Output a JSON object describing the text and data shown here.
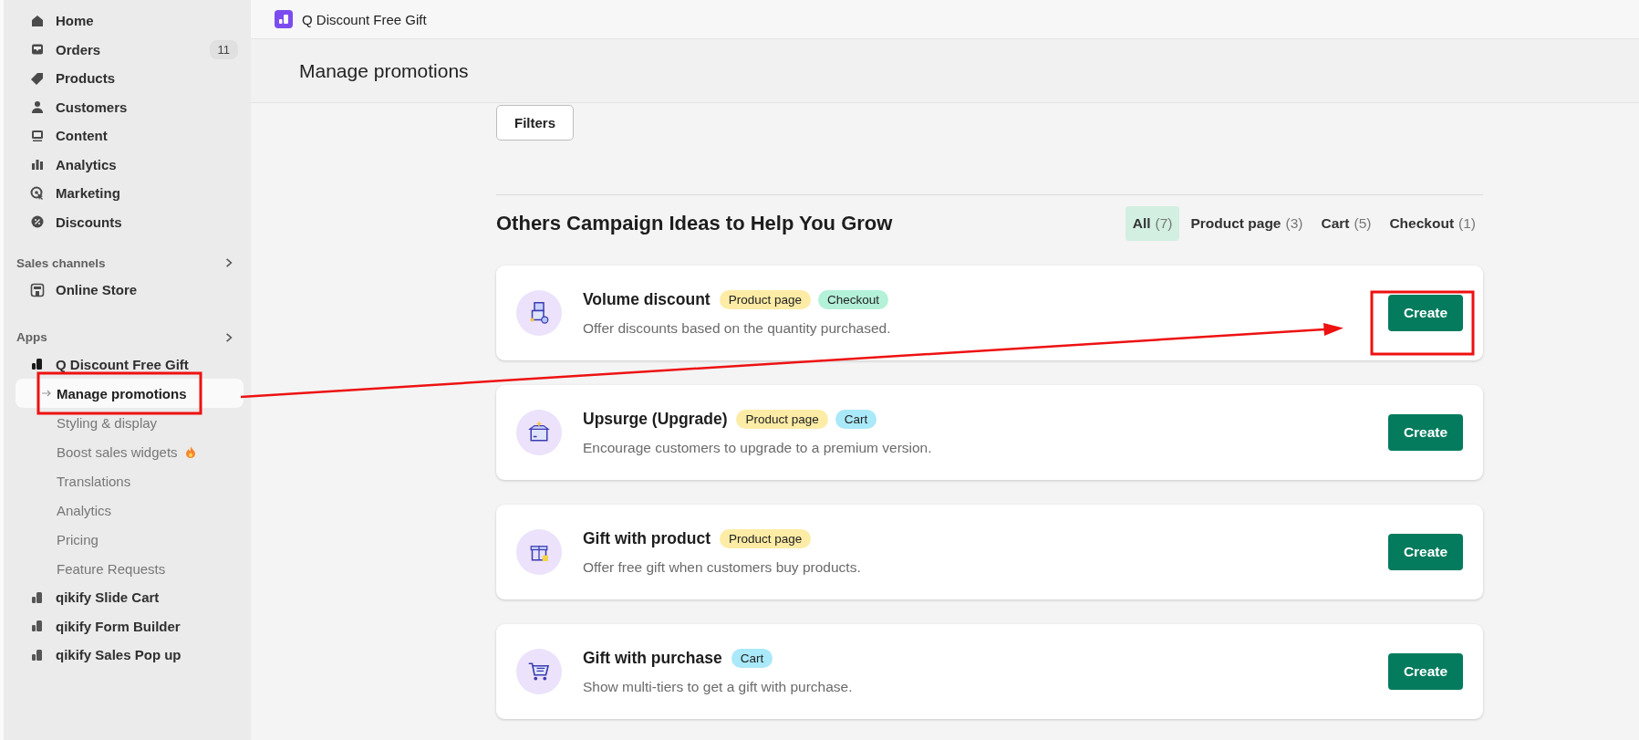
{
  "sidebar": {
    "nav": [
      {
        "label": "Home",
        "kind": "home",
        "selected": false
      },
      {
        "label": "Orders",
        "kind": "inbox",
        "badge": "11",
        "selected": false
      },
      {
        "label": "Products",
        "kind": "tag",
        "selected": false
      },
      {
        "label": "Customers",
        "kind": "person",
        "selected": false
      },
      {
        "label": "Content",
        "kind": "content",
        "selected": false
      },
      {
        "label": "Analytics",
        "kind": "bars",
        "selected": false
      },
      {
        "label": "Marketing",
        "kind": "target",
        "selected": false
      },
      {
        "label": "Discounts",
        "kind": "discount",
        "selected": false
      }
    ],
    "sales_channels": {
      "title": "Sales channels",
      "items": [
        {
          "label": "Online Store",
          "selected": false
        }
      ]
    },
    "apps": {
      "title": "Apps",
      "items": [
        {
          "label": "Q Discount Free Gift",
          "selected": false,
          "children": [
            {
              "label": "Manage promotions",
              "selected": true
            },
            {
              "label": "Styling & display",
              "selected": false
            },
            {
              "label": "Boost sales widgets",
              "hot": true,
              "selected": false
            },
            {
              "label": "Translations",
              "selected": false
            },
            {
              "label": "Analytics",
              "selected": false
            },
            {
              "label": "Pricing",
              "selected": false
            },
            {
              "label": "Feature Requests",
              "selected": false
            }
          ]
        },
        {
          "label": "qikify Slide Cart",
          "selected": false
        },
        {
          "label": "qikify Form Builder",
          "selected": false
        },
        {
          "label": "qikify Sales Pop up",
          "selected": false
        }
      ]
    }
  },
  "app_bar": {
    "title": "Q Discount Free Gift"
  },
  "page": {
    "title": "Manage promotions",
    "filters_button": "Filters",
    "ideas": {
      "heading": "Others Campaign Ideas to Help You Grow",
      "tabs": [
        {
          "label": "All",
          "count": "(7)",
          "selected": true
        },
        {
          "label": "Product page",
          "count": "(3)",
          "selected": false
        },
        {
          "label": "Cart",
          "count": "(5)",
          "selected": false
        },
        {
          "label": "Checkout",
          "count": "(1)",
          "selected": false
        }
      ],
      "cards": [
        {
          "title": "Volume discount",
          "kind": "boxes",
          "tags": [
            {
              "label": "Product page",
              "color": "#fdeca6"
            },
            {
              "label": "Checkout",
              "color": "#b4f1d9"
            }
          ],
          "description": "Offer discounts based on the quantity purchased.",
          "button": "Create"
        },
        {
          "title": "Upsurge (Upgrade)",
          "kind": "box",
          "tags": [
            {
              "label": "Product page",
              "color": "#fdeca6"
            },
            {
              "label": "Cart",
              "color": "#a9e9f9"
            }
          ],
          "description": "Encourage customers to upgrade to a premium version.",
          "button": "Create"
        },
        {
          "title": "Gift with product",
          "kind": "gift",
          "tags": [
            {
              "label": "Product page",
              "color": "#fdeca6"
            }
          ],
          "description": "Offer free gift when customers buy products.",
          "button": "Create"
        },
        {
          "title": "Gift with purchase",
          "kind": "cart",
          "tags": [
            {
              "label": "Cart",
              "color": "#a9e9f9"
            }
          ],
          "description": "Show multi-tiers to get a gift with purchase.",
          "button": "Create"
        }
      ]
    }
  }
}
